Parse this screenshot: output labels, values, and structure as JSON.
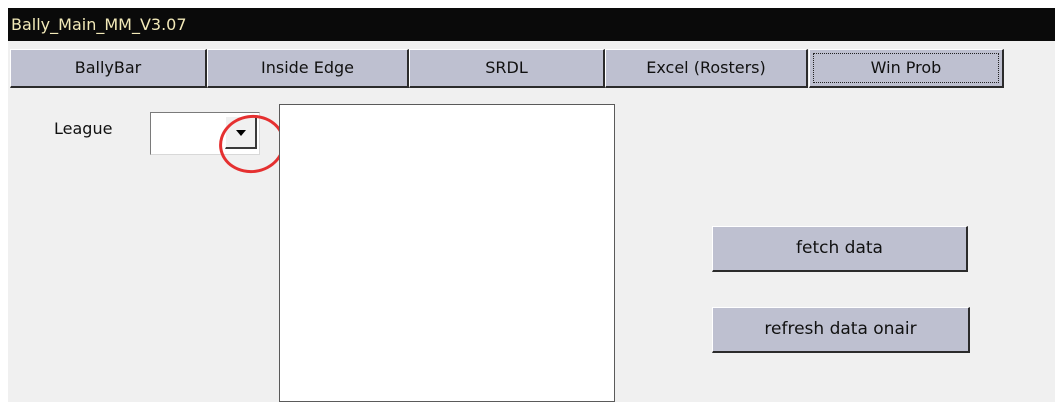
{
  "window": {
    "title": "Bally_Main_MM_V3.07"
  },
  "tabs": [
    {
      "label": "BallyBar"
    },
    {
      "label": "Inside Edge"
    },
    {
      "label": "SRDL"
    },
    {
      "label": "Excel (Rosters)"
    },
    {
      "label": "Win Prob",
      "active": true
    }
  ],
  "league": {
    "label": "League",
    "selected_value": ""
  },
  "actions": {
    "fetch_label": "fetch data",
    "refresh_label": "refresh data onair"
  },
  "colors": {
    "titlebar_bg": "#0a0a0a",
    "titlebar_text": "#f2e9b8",
    "button_face": "#bec0d0",
    "annotation": "#e53030"
  },
  "icons": {
    "dropdown": "chevron-down-icon"
  }
}
